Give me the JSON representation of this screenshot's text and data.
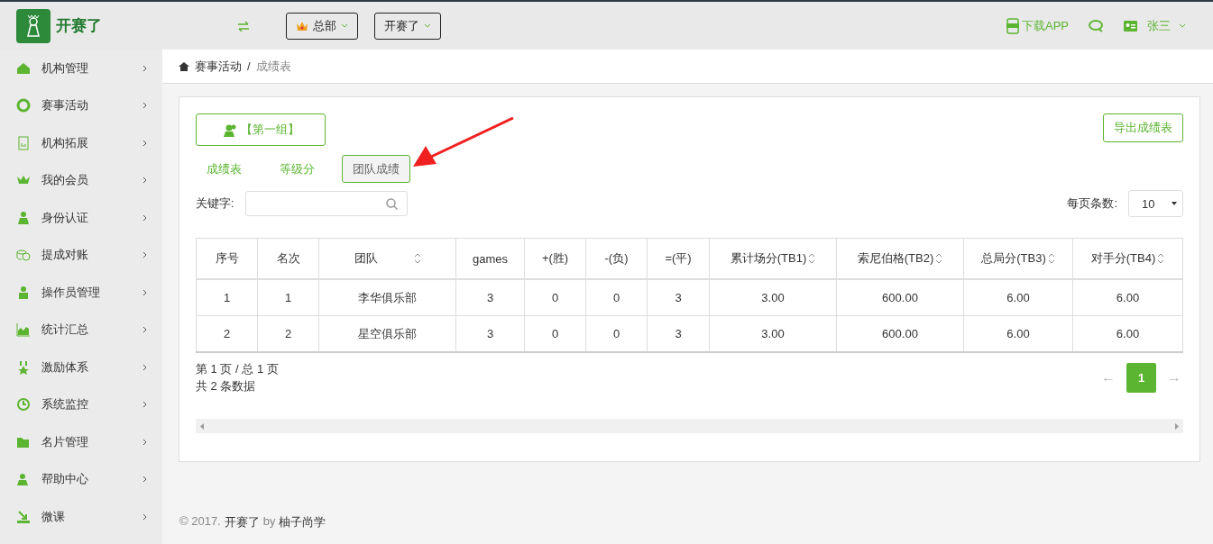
{
  "header": {
    "logo_text": "开赛了",
    "org_select": "总部",
    "app_select": "开赛了",
    "download": "下载APP",
    "user": "张三"
  },
  "sidebar": {
    "items": [
      {
        "label": "机构管理"
      },
      {
        "label": "赛事活动"
      },
      {
        "label": "机构拓展"
      },
      {
        "label": "我的会员"
      },
      {
        "label": "身份认证"
      },
      {
        "label": "提成对账"
      },
      {
        "label": "操作员管理"
      },
      {
        "label": "统计汇总"
      },
      {
        "label": "激励体系"
      },
      {
        "label": "系统监控"
      },
      {
        "label": "名片管理"
      },
      {
        "label": "帮助中心"
      },
      {
        "label": "微课"
      }
    ]
  },
  "breadcrumb": [
    "赛事活动",
    "/",
    "成绩表"
  ],
  "group_button": "【第一组】",
  "export_button": "导出成绩表",
  "tabs": [
    {
      "label": "成绩表",
      "selected": false
    },
    {
      "label": "等级分",
      "selected": false
    },
    {
      "label": "团队成绩",
      "selected": true
    }
  ],
  "search": {
    "label": "关键字:"
  },
  "page_size": {
    "label": "每页条数:",
    "value": "10"
  },
  "table": {
    "columns": [
      {
        "label": "序号",
        "sortable": false
      },
      {
        "label": "名次",
        "sortable": false
      },
      {
        "label": "团队",
        "sortable": true
      },
      {
        "label": "games",
        "sortable": false
      },
      {
        "label": "+(胜)",
        "sortable": false
      },
      {
        "label": "-(负)",
        "sortable": false
      },
      {
        "label": "=(平)",
        "sortable": false
      },
      {
        "label": "累计场分(TB1)",
        "sortable": true
      },
      {
        "label": "索尼伯格(TB2)",
        "sortable": true
      },
      {
        "label": "总局分(TB3)",
        "sortable": true
      },
      {
        "label": "对手分(TB4)",
        "sortable": true
      }
    ],
    "rows": [
      [
        "1",
        "1",
        "李华俱乐部",
        "3",
        "0",
        "0",
        "3",
        "3.00",
        "600.00",
        "6.00",
        "6.00"
      ],
      [
        "2",
        "2",
        "星空俱乐部",
        "3",
        "0",
        "0",
        "3",
        "3.00",
        "600.00",
        "6.00",
        "6.00"
      ]
    ]
  },
  "pagination": {
    "page_info": "第 1 页 / 总 1 页",
    "total": "共 2 条数据",
    "prev": "←",
    "pages": [
      {
        "label": "1",
        "selected": true
      }
    ],
    "next": "→"
  },
  "footer": {
    "copyright": "© 2017.",
    "brand": "开赛了",
    "by": "by",
    "author": "柚子尚学"
  }
}
